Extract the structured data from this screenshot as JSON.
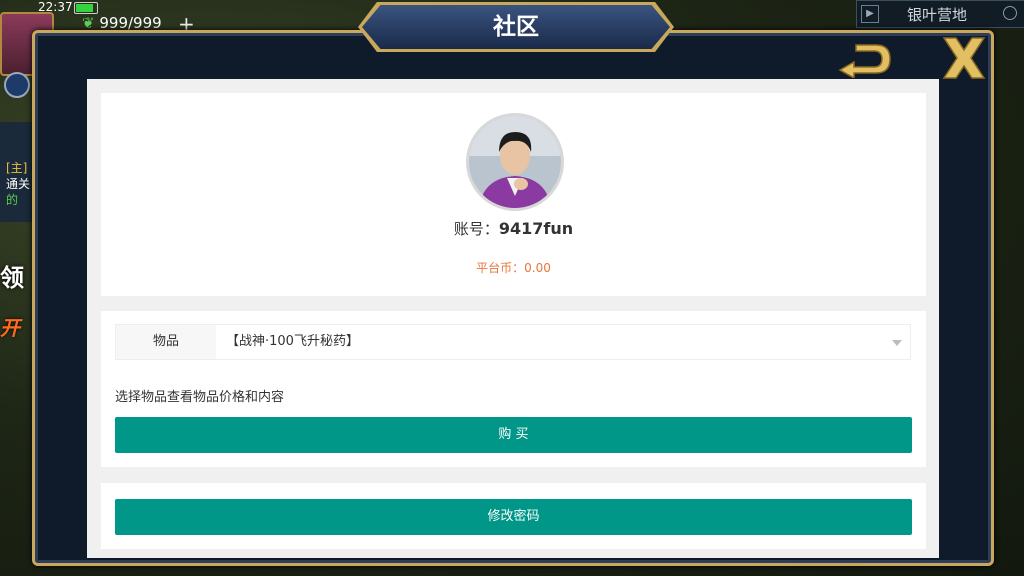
{
  "status_bar": {
    "time": "22:37"
  },
  "hud": {
    "leaf_count": "999/999",
    "plus": "+",
    "right_title": "银叶营地",
    "quest_tag": "[主]",
    "quest_line1": "通关",
    "quest_line2": "的",
    "left_big_text": "领",
    "left_red_text": "开"
  },
  "dialog": {
    "title": "社区",
    "back_icon": "back-arrow-icon",
    "close_icon": "close-x-icon"
  },
  "profile": {
    "account_label": "账号：",
    "account_id": "9417fun",
    "coin_label": "平台币：",
    "coin_value": "0.00"
  },
  "item_form": {
    "label": "物品",
    "selected": "【战神·100飞升秘药】",
    "hint": "选择物品查看物品价格和内容",
    "buy_label": "购 买"
  },
  "password": {
    "button_label": "修改密码"
  },
  "colors": {
    "accent": "#009688",
    "gold": "#c9a85c",
    "coin": "#e8763a",
    "frame_bg": "#0f1a2a"
  }
}
